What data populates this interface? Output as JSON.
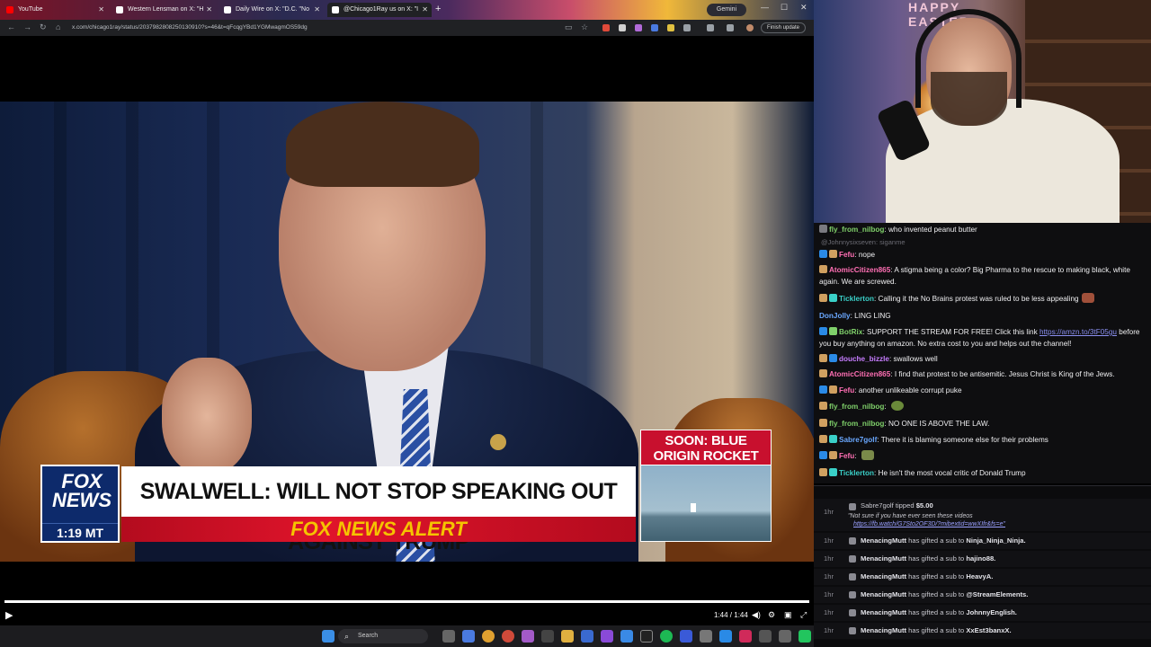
{
  "browser": {
    "tabs": [
      {
        "label": "YouTube",
        "icon": "youtube-icon",
        "color": "#ff0000"
      },
      {
        "label": "Western Lensman on X: \"H",
        "icon": "x-icon",
        "color": "#ffffff"
      },
      {
        "label": "Daily Wire on X: \"D.C. \"No",
        "icon": "x-icon",
        "color": "#ffffff"
      },
      {
        "label": "@Chicago1Ray us on X: \"I",
        "icon": "x-icon",
        "color": "#ffffff"
      }
    ],
    "new_tab": "+",
    "gemini_label": "Gemini",
    "url": "x.com/chicago1ray/status/2037982808250130910?s=46&t=qFcqgYBd1YGMwagmOS59dg",
    "finish_update": "Finish update"
  },
  "video": {
    "lower_third": {
      "headline": "SWALWELL: WILL NOT STOP SPEAKING OUT AGAINST TRUMP",
      "banner": "FOX NEWS ALERT",
      "logo_text": "FOX NEWS",
      "time": "1:19 MT",
      "soon_box": "SOON: BLUE ORIGIN ROCKET LAUNCH"
    },
    "progress_fraction": 1.0,
    "timecode": "1:44 / 1:44",
    "play_icon": "play-icon"
  },
  "taskbar": {
    "search_label": "Search"
  },
  "webcam": {
    "balloon_text": "HAPPY EASTER"
  },
  "chat": {
    "messages": [
      {
        "user": "fly_from_nilbog",
        "color": "#7fd06a",
        "text": "who invented peanut butter"
      },
      {
        "reply": "@Johnnysixseven: siganme"
      },
      {
        "user": "Fefu",
        "color": "#ff6fb4",
        "text": "nope"
      },
      {
        "user": "AtomicCitizen865",
        "color": "#ff6fb4",
        "text": "A stigma being a color? Big Pharma to the rescue to making black, white again. We are screwed."
      },
      {
        "user": "Ticklerton",
        "color": "#3ad0c8",
        "text": "Calling it the No Brains protest was ruled to be less appealing"
      },
      {
        "user": "DonJolly",
        "color": "#6aa8ff",
        "text": "LING LING"
      },
      {
        "user": "BotRix",
        "color": "#7fd06a",
        "text": "SUPPORT THE STREAM FOR FREE! Click this link",
        "link": "https://amzn.to/3tF05gu",
        "text2": "before you buy anything on amazon. No extra cost to you and helps out the channel!"
      },
      {
        "user": "douche_bizzle",
        "color": "#c77dff",
        "text": "swallows well"
      },
      {
        "user": "AtomicCitizen865",
        "color": "#ff6fb4",
        "text": "I find that protest to be antisemitic. Jesus Christ is King of the Jews."
      },
      {
        "user": "Fefu",
        "color": "#ff6fb4",
        "text": "another unlikeable corrupt puke"
      },
      {
        "user": "fly_from_nilbog",
        "color": "#7fd06a",
        "text": ""
      },
      {
        "user": "fly_from_nilbog",
        "color": "#7fd06a",
        "text": "NO ONE IS ABOVE THE LAW."
      },
      {
        "user": "Sabre7golf",
        "color": "#6aa8ff",
        "text": "There it is blaming someone else for their problems"
      },
      {
        "user": "Fefu",
        "color": "#ff6fb4",
        "text": ""
      },
      {
        "user": "Ticklerton",
        "color": "#3ad0c8",
        "text": "He isn't the most vocal critic of Donald Trump"
      }
    ]
  },
  "events": {
    "tip": {
      "time": "1hr",
      "user": "Sabre7golf",
      "action": "tipped",
      "amount": "$5.00",
      "note": "\"Not sure if you have ever seen these videos",
      "link": "https://fb.watch/G7Sto2OF3D/?mibextid=wwXIfr&fs=e\""
    },
    "gifts": [
      {
        "time": "1hr",
        "user": "MenacingMutt",
        "action": "has gifted a sub to",
        "target": "Ninja_Ninja_Ninja."
      },
      {
        "time": "1hr",
        "user": "MenacingMutt",
        "action": "has gifted a sub to",
        "target": "hajino88."
      },
      {
        "time": "1hr",
        "user": "MenacingMutt",
        "action": "has gifted a sub to",
        "target": "HeavyA."
      },
      {
        "time": "1hr",
        "user": "MenacingMutt",
        "action": "has gifted a sub to",
        "target": "@StreamElements."
      },
      {
        "time": "1hr",
        "user": "MenacingMutt",
        "action": "has gifted a sub to",
        "target": "JohnnyEnglish."
      },
      {
        "time": "1hr",
        "user": "MenacingMutt",
        "action": "has gifted a sub to",
        "target": "XxEst3banxX."
      }
    ]
  }
}
